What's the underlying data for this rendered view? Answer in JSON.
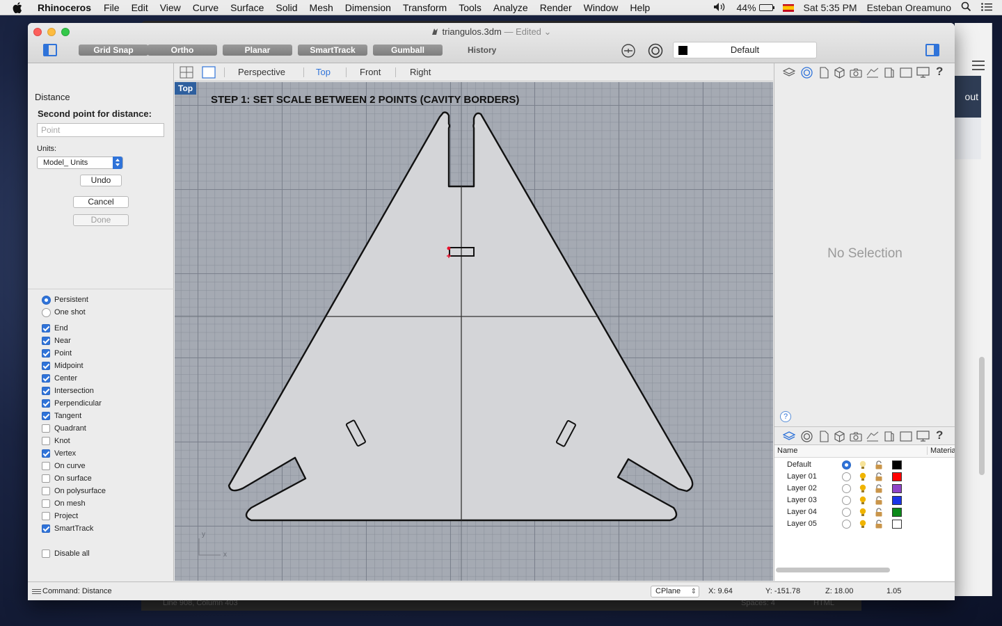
{
  "menubar": {
    "app_name": "Rhinoceros",
    "items": [
      "File",
      "Edit",
      "View",
      "Curve",
      "Surface",
      "Solid",
      "Mesh",
      "Dimension",
      "Transform",
      "Tools",
      "Analyze",
      "Render",
      "Window",
      "Help"
    ],
    "battery": "44%",
    "clock": "Sat 5:35 PM",
    "user": "Esteban Oreamuno"
  },
  "background_editor": {
    "status_position": "Line 908, Column 403",
    "status_spaces": "Spaces: 4",
    "status_syntax": "HTML"
  },
  "background_browser": {
    "partial_text": "out"
  },
  "window": {
    "file_name": "triangulos.3dm",
    "edited_label": "— Edited"
  },
  "toolbar": {
    "grid_snap": "Grid Snap",
    "ortho": "Ortho",
    "planar": "Planar",
    "smarttrack": "SmartTrack",
    "gumball": "Gumball",
    "history": "History",
    "current_layer": "Default"
  },
  "command_panel": {
    "title": "Distance",
    "prompt": "Second point for distance:",
    "point_placeholder": "Point",
    "units_label": "Units:",
    "units_value": "Model_ Units",
    "undo": "Undo",
    "cancel": "Cancel",
    "done": "Done"
  },
  "osnap": {
    "mode_persistent": "Persistent",
    "mode_one_shot": "One shot",
    "mode_selected": "Persistent",
    "items": [
      {
        "label": "End",
        "checked": true
      },
      {
        "label": "Near",
        "checked": true
      },
      {
        "label": "Point",
        "checked": true
      },
      {
        "label": "Midpoint",
        "checked": true
      },
      {
        "label": "Center",
        "checked": true
      },
      {
        "label": "Intersection",
        "checked": true
      },
      {
        "label": "Perpendicular",
        "checked": true
      },
      {
        "label": "Tangent",
        "checked": true
      },
      {
        "label": "Quadrant",
        "checked": false
      },
      {
        "label": "Knot",
        "checked": false
      },
      {
        "label": "Vertex",
        "checked": true
      },
      {
        "label": "On curve",
        "checked": false
      },
      {
        "label": "On surface",
        "checked": false
      },
      {
        "label": "On polysurface",
        "checked": false
      },
      {
        "label": "On mesh",
        "checked": false
      },
      {
        "label": "Project",
        "checked": false
      },
      {
        "label": "SmartTrack",
        "checked": true
      }
    ],
    "disable_all": "Disable all"
  },
  "viewport_tabs": [
    "Perspective",
    "Top",
    "Front",
    "Right"
  ],
  "viewport_active": "Top",
  "viewport": {
    "label": "Top",
    "annotation": "STEP 1: SET SCALE BETWEEN 2 POINTS (CAVITY BORDERS)",
    "axis_x": "x",
    "axis_y": "y"
  },
  "properties": {
    "empty_text": "No Selection",
    "help": "?"
  },
  "layers": {
    "col_name": "Name",
    "col_material": "Materia",
    "rows": [
      {
        "name": "Default",
        "current": true,
        "color": "#000000"
      },
      {
        "name": "Layer 01",
        "current": false,
        "color": "#ff0000"
      },
      {
        "name": "Layer 02",
        "current": false,
        "color": "#8e44c8"
      },
      {
        "name": "Layer 03",
        "current": false,
        "color": "#1a35e8"
      },
      {
        "name": "Layer 04",
        "current": false,
        "color": "#0c8a1a"
      },
      {
        "name": "Layer 05",
        "current": false,
        "color": "#ffffff"
      }
    ],
    "add": "+",
    "remove": "—",
    "gear": "⚙ ⌄"
  },
  "statusbar": {
    "command": "Command:  Distance",
    "cplane": "CPlane",
    "x": "X: 9.64",
    "y": "Y: -151.78",
    "z": "Z: 18.00",
    "extra": "1.05"
  },
  "colors": {
    "accent": "#2f73d9",
    "viewport_bg": "#a5aab3",
    "part_fill": "#d4d5d8",
    "snap_marker": "#e8112d"
  }
}
